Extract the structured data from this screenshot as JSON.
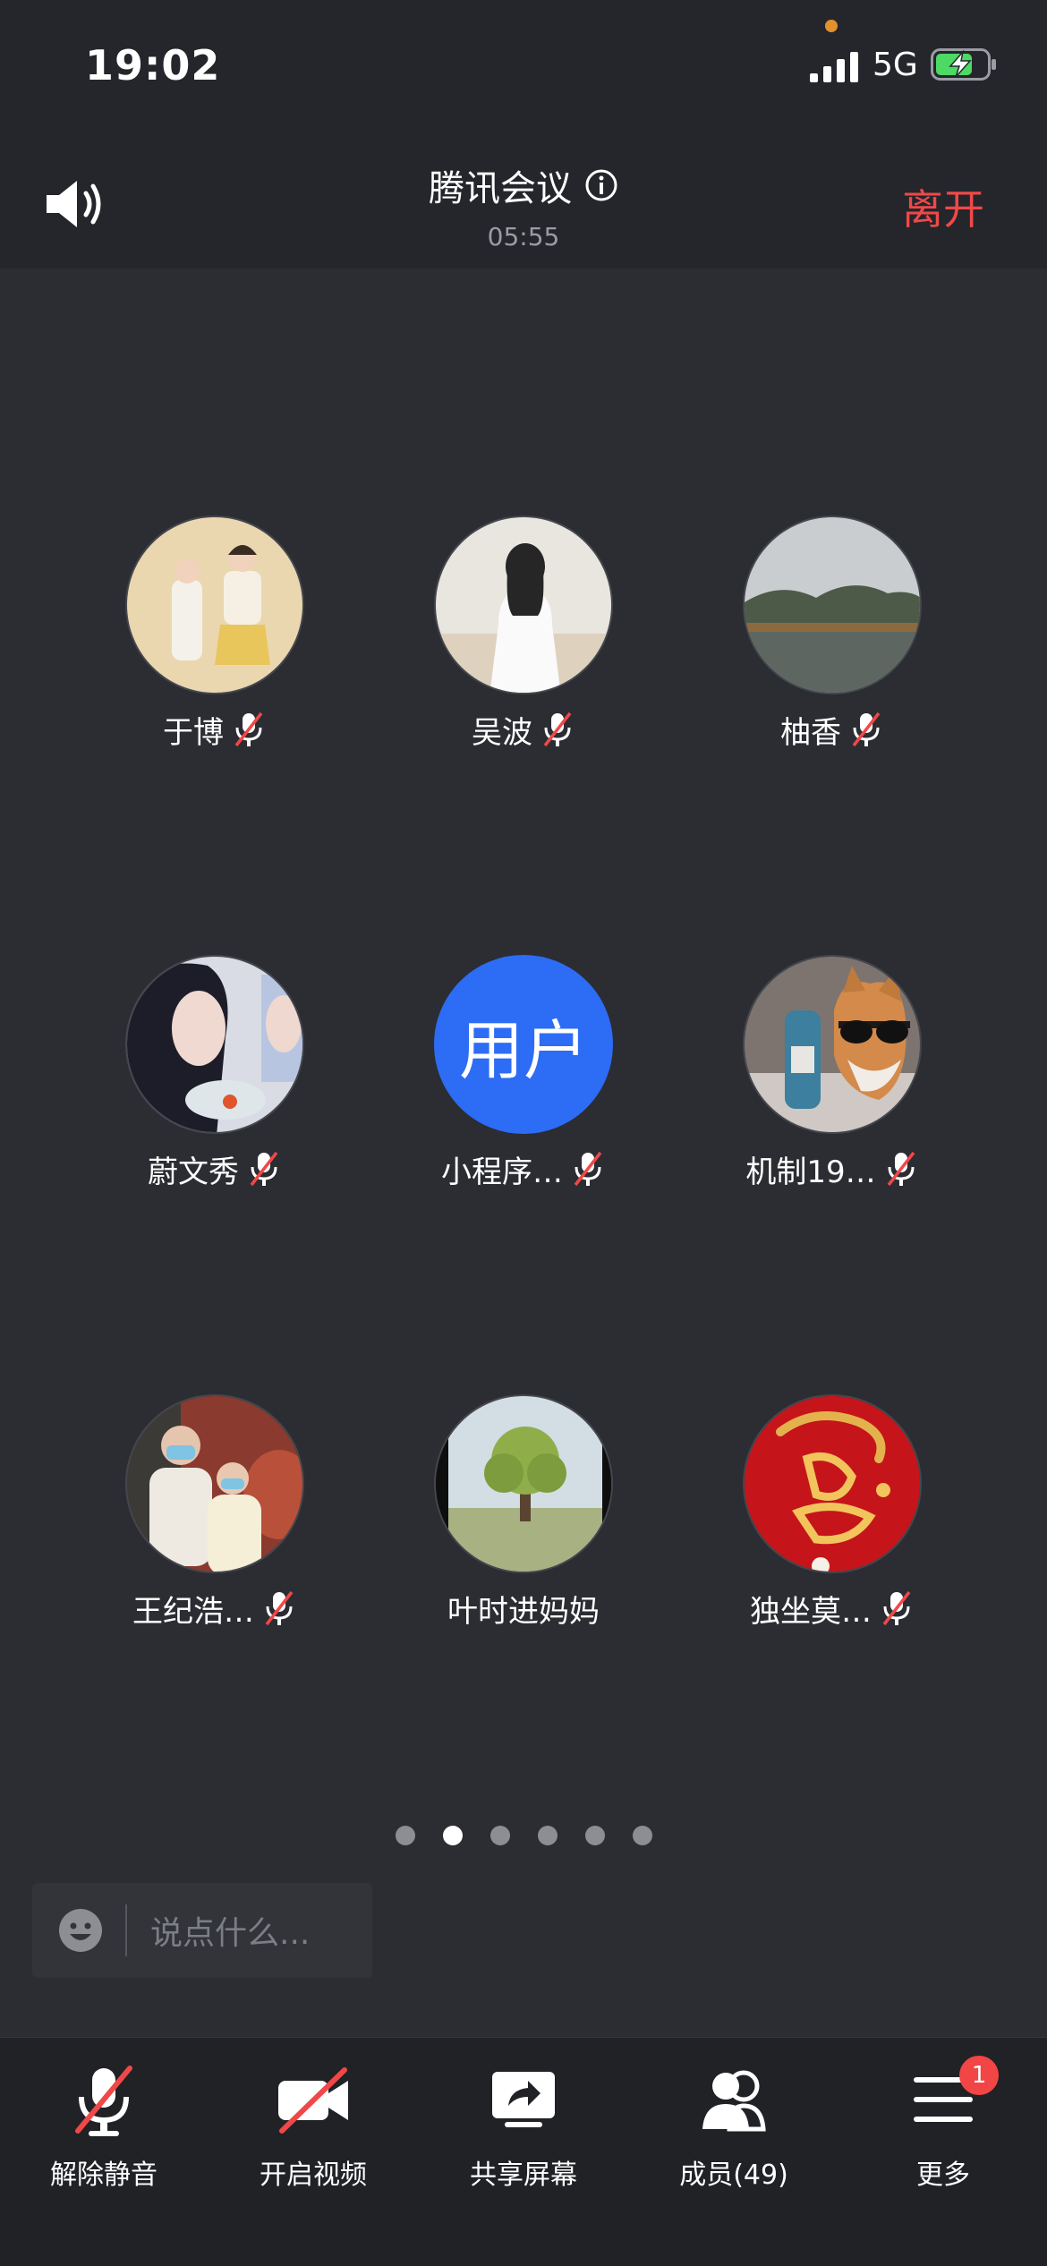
{
  "status_bar": {
    "time": "19:02",
    "network": "5G"
  },
  "header": {
    "title": "腾讯会议",
    "timer": "05:55",
    "leave_label": "离开"
  },
  "participants": [
    {
      "name": "于博",
      "muted": true,
      "avatar": "photo"
    },
    {
      "name": "吴波",
      "muted": true,
      "avatar": "photo"
    },
    {
      "name": "柚香",
      "muted": true,
      "avatar": "photo"
    },
    {
      "name": "蔚文秀",
      "muted": true,
      "avatar": "photo"
    },
    {
      "name": "小程序…",
      "muted": true,
      "avatar": "text",
      "avatar_text": "用户"
    },
    {
      "name": "机制19…",
      "muted": true,
      "avatar": "photo"
    },
    {
      "name": "王纪浩…",
      "muted": true,
      "avatar": "photo"
    },
    {
      "name": "叶时进妈妈",
      "muted": false,
      "avatar": "photo"
    },
    {
      "name": "独坐莫…",
      "muted": true,
      "avatar": "photo"
    }
  ],
  "pagination": {
    "pages": 6,
    "current": 2
  },
  "chat": {
    "placeholder": "说点什么..."
  },
  "toolbar": {
    "unmute_label": "解除静音",
    "video_label": "开启视频",
    "share_label": "共享屏幕",
    "members_label": "成员(49)",
    "more_label": "更多",
    "more_badge": "1"
  },
  "colors": {
    "background": "#2b2d33",
    "leave": "#f04848",
    "accent_blue": "#2d6cf5",
    "badge": "#f24545"
  }
}
